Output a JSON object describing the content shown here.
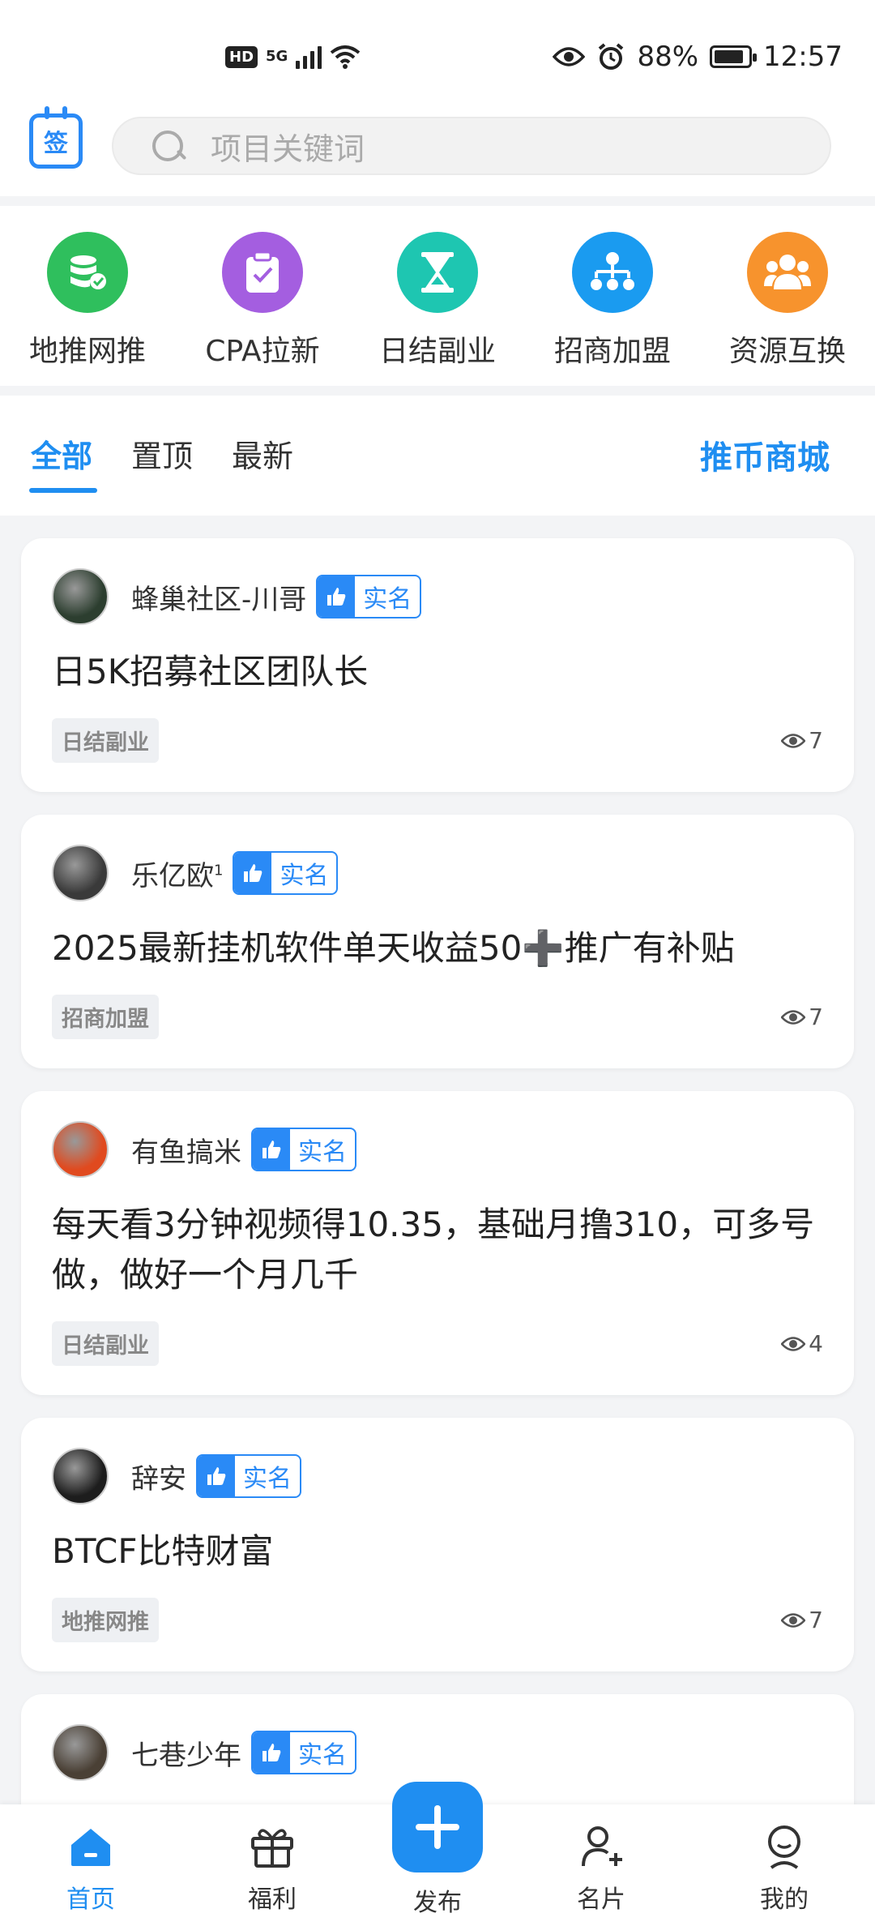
{
  "status_bar": {
    "hd": "HD",
    "network": "5G",
    "battery": "88%",
    "battery_level": 0.88,
    "time": "12:57"
  },
  "header": {
    "sign_label": "签",
    "search_placeholder": "项目关键词"
  },
  "categories": [
    {
      "label": "地推网推",
      "color": "#2fbf5d",
      "icon": "database-icon"
    },
    {
      "label": "CPA拉新",
      "color": "#a45ee0",
      "icon": "clipboard-check-icon"
    },
    {
      "label": "日结副业",
      "color": "#1ec6b1",
      "icon": "hourglass-icon"
    },
    {
      "label": "招商加盟",
      "color": "#1a9bf0",
      "icon": "org-chart-icon"
    },
    {
      "label": "资源互换",
      "color": "#f7932d",
      "icon": "people-icon"
    }
  ],
  "tabs": {
    "items": [
      "全部",
      "置顶",
      "最新"
    ],
    "mall": "推币商城"
  },
  "verify_label": "实名",
  "posts": [
    {
      "author": "蜂巢社区-川哥",
      "title": "日5K招募社区团队长",
      "tag": "日结副业",
      "views": "7",
      "avatar_color": "#2c3e2f"
    },
    {
      "author": "乐亿欧",
      "sup": "1",
      "title": "2025最新挂机软件单天收益50➕推广有补贴",
      "tag": "招商加盟",
      "views": "7",
      "avatar_color": "#3a3a3a"
    },
    {
      "author": "有鱼搞米",
      "title": "每天看3分钟视频得10.35，基础月撸310，可多号做，做好一个月几千",
      "tag": "日结副业",
      "views": "4",
      "avatar_color": "#e04a1f"
    },
    {
      "author": "辞安",
      "title": "BTCF比特财富",
      "tag": "地推网推",
      "views": "7",
      "avatar_color": "#1d1d1d"
    },
    {
      "author": "七巷少年",
      "title": "",
      "tag": "",
      "views": "",
      "avatar_color": "#4a4035"
    }
  ],
  "bottom_nav": {
    "home": "首页",
    "welfare": "福利",
    "publish": "发布",
    "card": "名片",
    "mine": "我的"
  }
}
